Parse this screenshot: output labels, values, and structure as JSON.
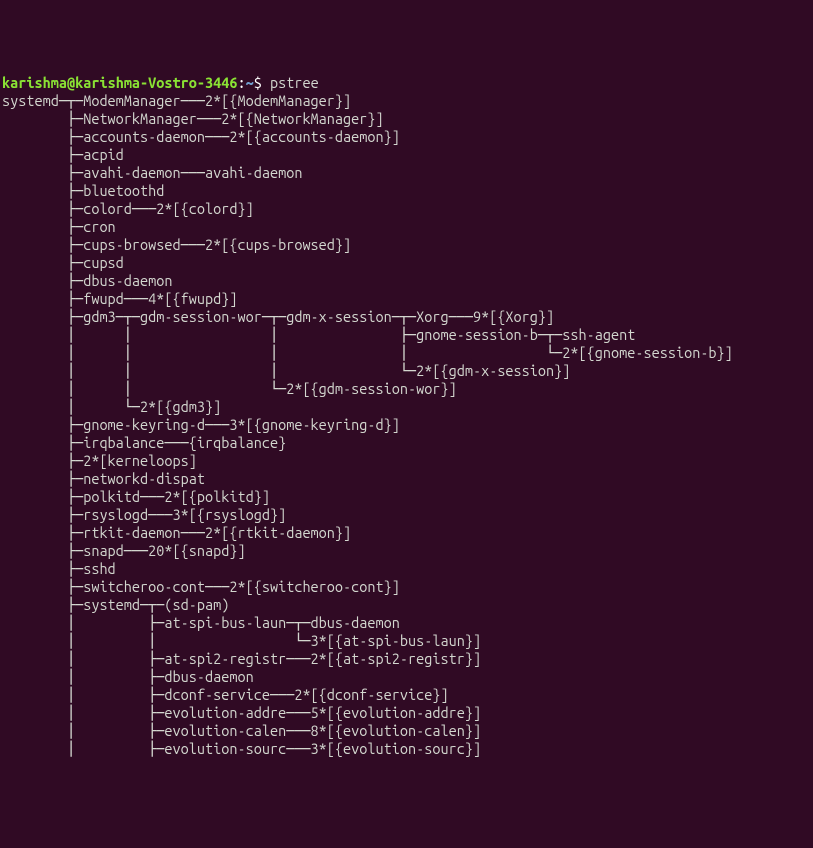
{
  "prompt": {
    "user": "karishma",
    "host": "karishma-Vostro-3446",
    "sep1": "@",
    "colon": ":",
    "path": "~",
    "dollar": "$ ",
    "command": "pstree"
  },
  "tree_lines": [
    "systemd─┬─ModemManager───2*[{ModemManager}]",
    "        ├─NetworkManager───2*[{NetworkManager}]",
    "        ├─accounts-daemon───2*[{accounts-daemon}]",
    "        ├─acpid",
    "        ├─avahi-daemon───avahi-daemon",
    "        ├─bluetoothd",
    "        ├─colord───2*[{colord}]",
    "        ├─cron",
    "        ├─cups-browsed───2*[{cups-browsed}]",
    "        ├─cupsd",
    "        ├─dbus-daemon",
    "        ├─fwupd───4*[{fwupd}]",
    "        ├─gdm3─┬─gdm-session-wor─┬─gdm-x-session─┬─Xorg───9*[{Xorg}]",
    "        │      │                 │               ├─gnome-session-b─┬─ssh-agent",
    "        │      │                 │               │                 └─2*[{gnome-session-b}]",
    "        │      │                 │               └─2*[{gdm-x-session}]",
    "        │      │                 └─2*[{gdm-session-wor}]",
    "        │      └─2*[{gdm3}]",
    "        ├─gnome-keyring-d───3*[{gnome-keyring-d}]",
    "        ├─irqbalance───{irqbalance}",
    "        ├─2*[kerneloops]",
    "        ├─networkd-dispat",
    "        ├─polkitd───2*[{polkitd}]",
    "        ├─rsyslogd───3*[{rsyslogd}]",
    "        ├─rtkit-daemon───2*[{rtkit-daemon}]",
    "        ├─snapd───20*[{snapd}]",
    "        ├─sshd",
    "        ├─switcheroo-cont───2*[{switcheroo-cont}]",
    "        ├─systemd─┬─(sd-pam)",
    "        │         ├─at-spi-bus-laun─┬─dbus-daemon",
    "        │         │                 └─3*[{at-spi-bus-laun}]",
    "        │         ├─at-spi2-registr───2*[{at-spi2-registr}]",
    "        │         ├─dbus-daemon",
    "        │         ├─dconf-service───2*[{dconf-service}]",
    "        │         ├─evolution-addre───5*[{evolution-addre}]",
    "        │         ├─evolution-calen───8*[{evolution-calen}]",
    "        │         ├─evolution-sourc───3*[{evolution-sourc}]"
  ]
}
